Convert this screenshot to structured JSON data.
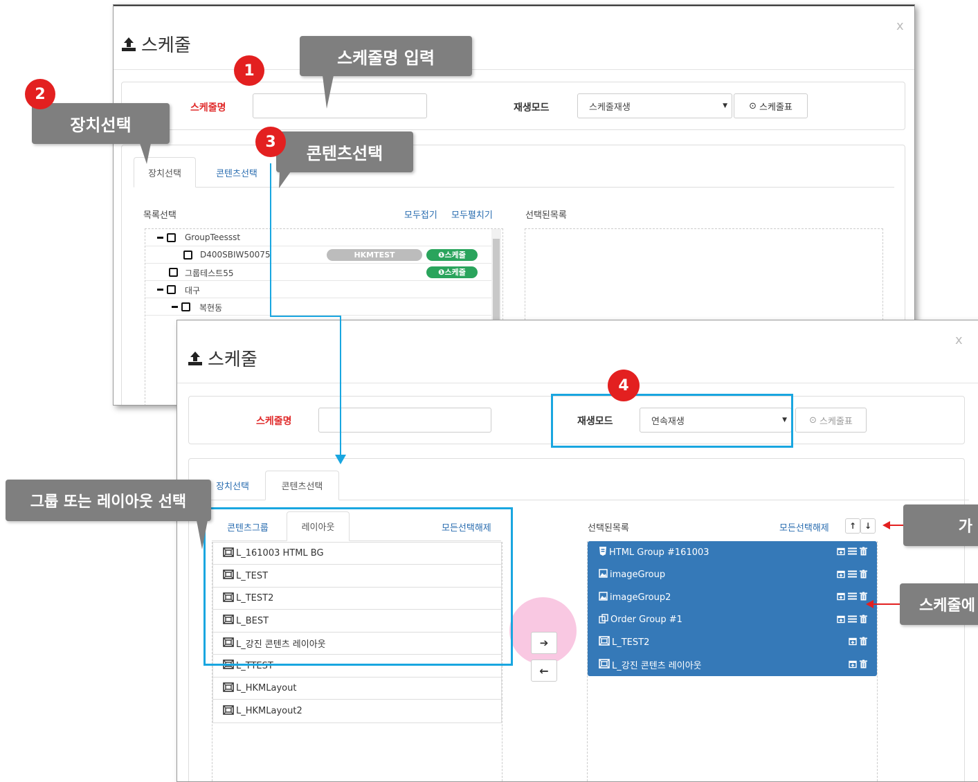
{
  "dialog_back": {
    "title": "스케줄",
    "close": "x",
    "schedule_name_label": "스케줄명",
    "schedule_name_value": "",
    "play_mode_label": "재생모드",
    "play_mode_value": "스케줄재생",
    "schedule_table_btn": "스케줄표",
    "tabs": [
      "장치선택",
      "콘텐츠선택"
    ],
    "list_select_label": "목록선택",
    "collapse_all": "모두접기",
    "expand_all": "모두펼치기",
    "selected_list_label": "선택된목록",
    "tree": [
      {
        "label": "GroupTeessst"
      },
      {
        "label": "D400SBIW50075",
        "tag": "HKMTEST",
        "badge": "스케줄"
      },
      {
        "label": "그룹테스트55",
        "badge": "스케줄"
      },
      {
        "label": "대구"
      },
      {
        "label": "복현동"
      }
    ]
  },
  "dialog_front": {
    "title": "스케줄",
    "close": "x",
    "schedule_name_label": "스케줄명",
    "schedule_name_value": "",
    "play_mode_label": "재생모드",
    "play_mode_value": "연속재생",
    "schedule_table_btn": "스케줄표",
    "tabs": [
      "장치선택",
      "콘텐츠선택"
    ],
    "sub_tabs": [
      "콘텐츠그룹",
      "레이아웃"
    ],
    "deselect_all_left": "모든선택해제",
    "selected_list_label": "선택된목록",
    "deselect_all_right": "모든선택해제",
    "layouts": [
      "L_161003 HTML BG",
      "L_TEST",
      "L_TEST2",
      "L_BEST",
      "L_강진 콘텐츠 레이아웃",
      "L_TTEST",
      "L_HKMLayout",
      "L_HKMLayout2"
    ],
    "selected": [
      {
        "label": "HTML Group #161003",
        "icon": "html5-icon"
      },
      {
        "label": "imageGroup",
        "icon": "image-icon"
      },
      {
        "label": "imageGroup2",
        "icon": "image-icon"
      },
      {
        "label": "Order Group #1",
        "icon": "copy-icon"
      },
      {
        "label": "L_TEST2",
        "icon": "layout-icon"
      },
      {
        "label": "L_강진 콘텐츠 레이아웃",
        "icon": "layout-icon"
      }
    ]
  },
  "callouts": {
    "c1": "스케줄명 입력",
    "c2": "장치선택",
    "c3": "콘텐츠선택",
    "c_group": "그룹 또는 레이아웃 선택",
    "c_right_top": "가",
    "c_right_mid": "스케줄에"
  },
  "badges": [
    "1",
    "2",
    "3",
    "4"
  ],
  "colors": {
    "callout": "#7f7f7f",
    "badge": "#e32020",
    "highlight_box": "#19a6e0",
    "selected_bg": "#3579b8",
    "link": "#2a6db0",
    "green_badge": "#2aa45c"
  }
}
